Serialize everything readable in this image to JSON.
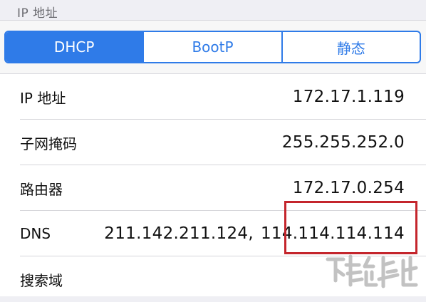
{
  "section_header": "IP 地址",
  "segments": {
    "items": [
      "DHCP",
      "BootP",
      "静态"
    ],
    "selected": "DHCP"
  },
  "rows": [
    {
      "label": "IP 地址",
      "value": "172.17.1.119"
    },
    {
      "label": "子网掩码",
      "value": "255.255.252.0"
    },
    {
      "label": "路由器",
      "value": "172.17.0.254"
    },
    {
      "label": "DNS",
      "value_primary": "211.142.211.124,",
      "value_secondary": "114.114.114.114"
    },
    {
      "label": "搜索域",
      "value": ""
    }
  ],
  "colors": {
    "accent": "#2f7be8",
    "highlight_box": "#c4252c",
    "background": "#efeff4"
  },
  "watermark": {
    "icon": "download-site-logo"
  }
}
